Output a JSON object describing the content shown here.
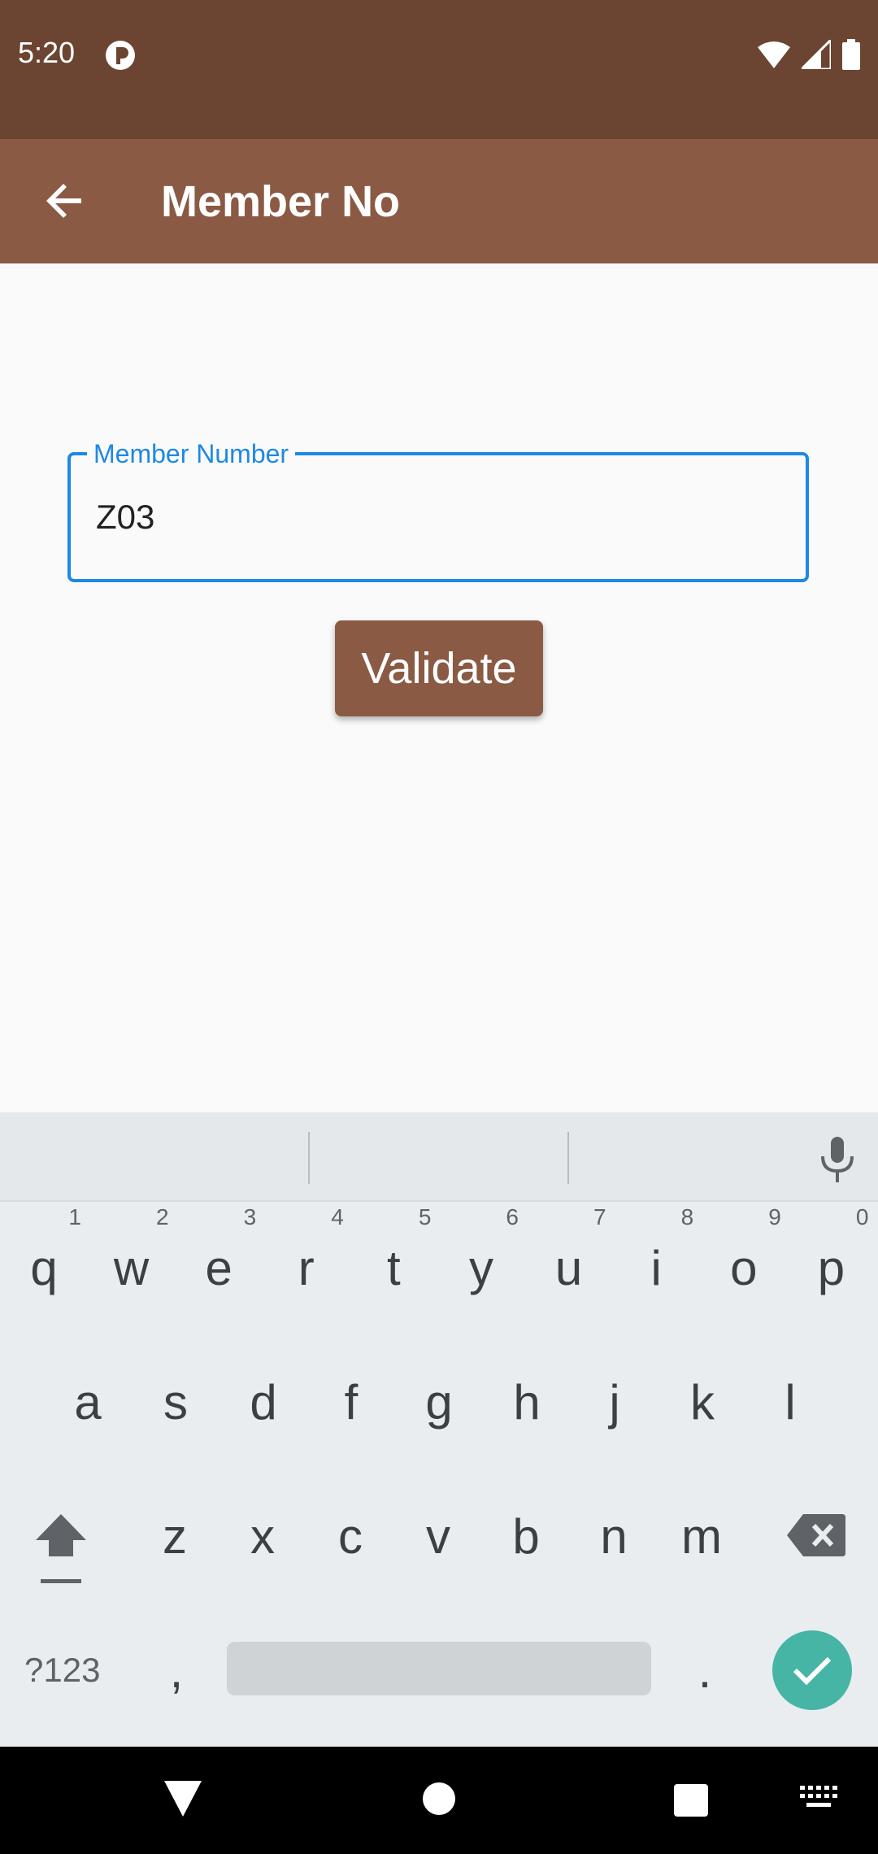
{
  "status_bar": {
    "time": "5:20"
  },
  "app_bar": {
    "title": "Member No"
  },
  "form": {
    "field_label": "Member Number",
    "field_value": "Z03",
    "validate_label": "Validate"
  },
  "keyboard": {
    "row1": [
      {
        "key": "q",
        "hint": "1"
      },
      {
        "key": "w",
        "hint": "2"
      },
      {
        "key": "e",
        "hint": "3"
      },
      {
        "key": "r",
        "hint": "4"
      },
      {
        "key": "t",
        "hint": "5"
      },
      {
        "key": "y",
        "hint": "6"
      },
      {
        "key": "u",
        "hint": "7"
      },
      {
        "key": "i",
        "hint": "8"
      },
      {
        "key": "o",
        "hint": "9"
      },
      {
        "key": "p",
        "hint": "0"
      }
    ],
    "row2": [
      "a",
      "s",
      "d",
      "f",
      "g",
      "h",
      "j",
      "k",
      "l"
    ],
    "row3": [
      "z",
      "x",
      "c",
      "v",
      "b",
      "n",
      "m"
    ],
    "symbols_label": "?123",
    "comma": ",",
    "period": "."
  },
  "colors": {
    "status_bar": "#6b4532",
    "app_bar": "#8a5a44",
    "accent": "#1e88e5",
    "enter": "#46b5a5"
  }
}
